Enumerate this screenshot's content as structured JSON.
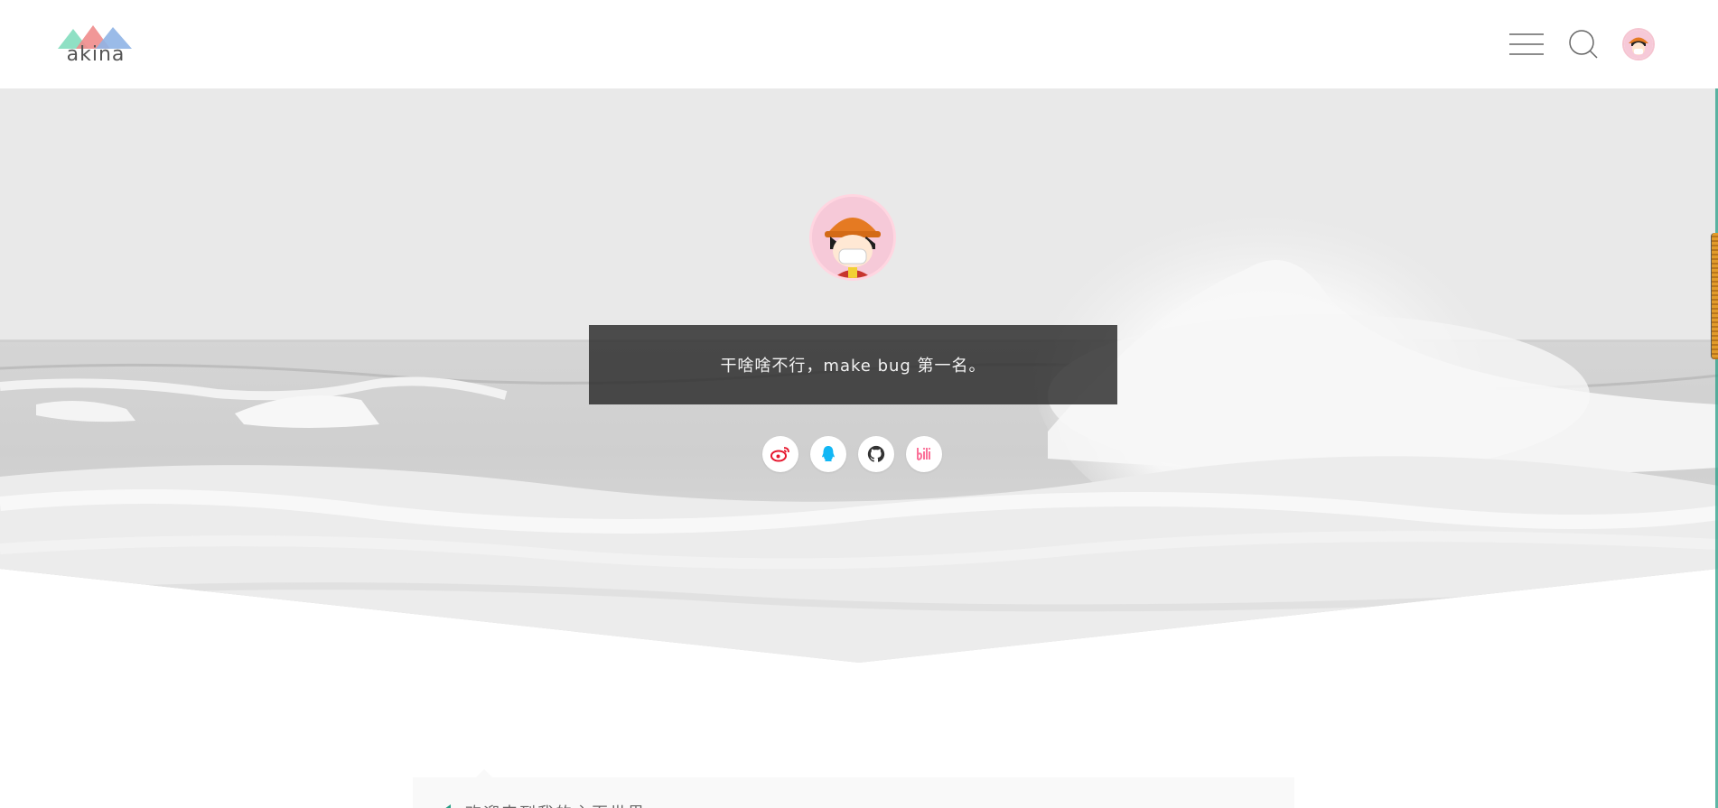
{
  "header": {
    "logo_text": "akina",
    "menu_icon": "hamburger-menu-icon",
    "search_icon": "search-icon",
    "user_avatar": "user-avatar"
  },
  "hero": {
    "motto": "干啥啥不行，make bug 第一名。",
    "socials": [
      {
        "name": "weibo",
        "icon": "weibo-icon",
        "color": "#e6162d"
      },
      {
        "name": "qq",
        "icon": "qq-icon",
        "color": "#12b7f5"
      },
      {
        "name": "github",
        "icon": "github-icon",
        "color": "#333333"
      },
      {
        "name": "bilibili",
        "icon": "bilibili-icon",
        "color": "#fb7299"
      }
    ]
  },
  "notice": {
    "text": "欢迎来到我的主页世界"
  },
  "colors": {
    "accent": "#2a9e87",
    "logo_green": "#8fe0c4",
    "logo_red": "#f08c8c",
    "logo_blue": "#8fb4e6"
  }
}
